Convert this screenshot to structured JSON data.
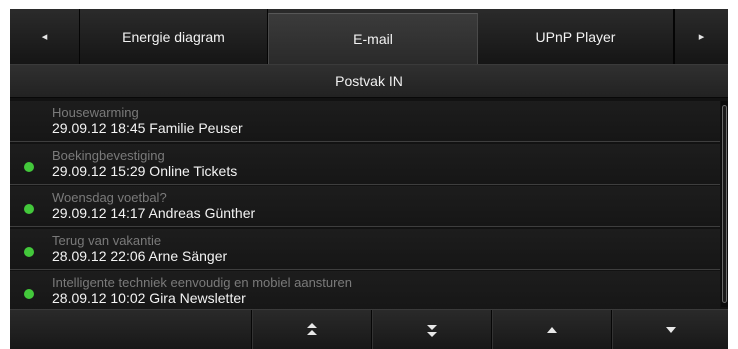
{
  "tabs": {
    "prev_glyph": "◂",
    "next_glyph": "▸",
    "items": [
      {
        "label": "Energie diagram",
        "active": false
      },
      {
        "label": "E-mail",
        "active": true
      },
      {
        "label": "UPnP Player",
        "active": false
      }
    ]
  },
  "folder": {
    "title": "Postvak IN"
  },
  "mails": [
    {
      "subject": "Housewarming",
      "meta": "29.09.12 18:45 Familie Peuser",
      "unread": false
    },
    {
      "subject": "Boekingbevestiging",
      "meta": "29.09.12 15:29 Online Tickets",
      "unread": true
    },
    {
      "subject": "Woensdag voetbal?",
      "meta": "29.09.12 14:17 Andreas Günther",
      "unread": true
    },
    {
      "subject": "Terug van vakantie",
      "meta": "28.09.12 22:06 Arne Sänger",
      "unread": true
    },
    {
      "subject": "Intelligente techniek eenvoudig en mobiel aansturen",
      "meta": "28.09.12 10:02 Gira Newsletter",
      "unread": true
    }
  ],
  "colors": {
    "unread_dot": "#43c83b",
    "background": "#121212",
    "subject_text": "#7a7a7a",
    "meta_text": "#f4f4f4"
  },
  "toolbar": {
    "icons": [
      "page-up-icon",
      "page-down-icon",
      "up-icon",
      "down-icon"
    ]
  }
}
